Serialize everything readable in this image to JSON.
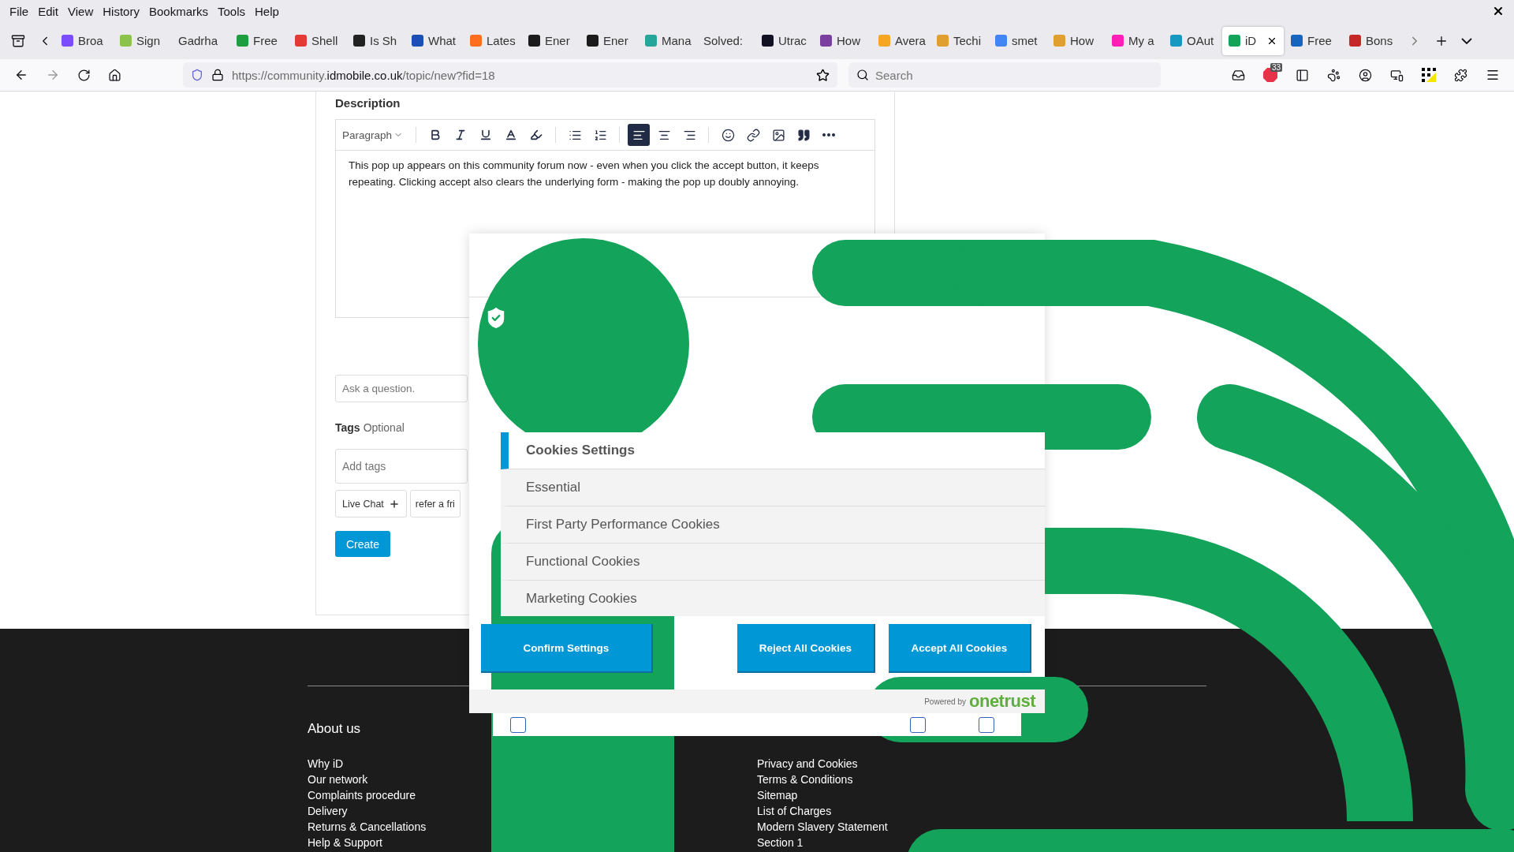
{
  "menu_bar": [
    "File",
    "Edit",
    "View",
    "History",
    "Bookmarks",
    "Tools",
    "Help"
  ],
  "tabs": [
    {
      "label": "Broa",
      "color": "#7c4dff",
      "selected": false
    },
    {
      "label": "Sign",
      "color": "#8bc34a",
      "selected": false
    },
    {
      "label": "Gadrha",
      "selected": false
    },
    {
      "label": "Free",
      "color": "#1e9e3e",
      "selected": false
    },
    {
      "label": "Shell",
      "color": "#e53935",
      "selected": false
    },
    {
      "label": "Is Sh",
      "color": "#222222",
      "selected": false
    },
    {
      "label": "What",
      "color": "#1a4fb5",
      "selected": false
    },
    {
      "label": "Lates",
      "color": "#ff6d1f",
      "selected": false
    },
    {
      "label": "Ener",
      "color": "#1b1b1b",
      "selected": false
    },
    {
      "label": "Ener",
      "color": "#1b1b1b",
      "selected": false
    },
    {
      "label": "Mana",
      "color": "#26a69a",
      "selected": false
    },
    {
      "label": "Solved:",
      "selected": false
    },
    {
      "label": "Utrac",
      "color": "#111122",
      "selected": false
    },
    {
      "label": "How",
      "color": "#7b3fa0",
      "selected": false
    },
    {
      "label": "Avera",
      "color": "#f5a623",
      "selected": false
    },
    {
      "label": "Techi",
      "color": "#e0a030",
      "selected": false
    },
    {
      "label": "smet",
      "color": "#4285f4",
      "selected": false
    },
    {
      "label": "How",
      "color": "#e0a030",
      "selected": false
    },
    {
      "label": "My a",
      "color": "#ff1fb8",
      "selected": false
    },
    {
      "label": "OAut",
      "color": "#1798c1",
      "selected": false
    },
    {
      "label": "iD",
      "color": "#13a35a",
      "selected": true
    },
    {
      "label": "Free",
      "color": "#1565c0",
      "selected": false
    },
    {
      "label": "Bons",
      "color": "#c62828",
      "selected": false
    }
  ],
  "address_bar": {
    "url_prefix": "https://community.",
    "url_domain": "idmobile.co.uk",
    "url_path": "/topic/new?fid=18"
  },
  "search": {
    "placeholder": "Search"
  },
  "adblock_badge": "33",
  "form": {
    "description_label": "Description",
    "editor": {
      "format_label": "Paragraph",
      "align_buttons": [
        {
          "selected": true
        },
        {
          "selected": false
        },
        {
          "selected": false
        }
      ],
      "text": "This pop up appears on this community forum now - even when you click the accept button, it keeps repeating. Clicking accept also clears the underlying form - making the pop up doubly annoying."
    },
    "question_placeholder": "Ask a question.",
    "tags_label": "Tags",
    "tags_optional": "Optional",
    "tags_placeholder": "Add tags",
    "tag_chips": [
      "Live Chat",
      "refer a fri"
    ],
    "create_button": "Create"
  },
  "cookie_popup": {
    "menu": [
      {
        "label": "Cookies Settings",
        "selected": true
      },
      {
        "label": "Essential",
        "selected": false
      },
      {
        "label": "First Party Performance Cookies",
        "selected": false
      },
      {
        "label": "Functional Cookies",
        "selected": false
      },
      {
        "label": "Marketing Cookies",
        "selected": false
      }
    ],
    "buttons": [
      "Confirm Settings",
      "Reject All Cookies",
      "Accept All Cookies"
    ],
    "powered_by": "Powered by",
    "brand": "onetrust",
    "checkboxes": [
      {
        "checked": false
      },
      {
        "checked": false
      },
      {
        "checked": false
      }
    ]
  },
  "footer": {
    "about_heading": "About us",
    "about_links": [
      "Why iD",
      "Our network",
      "Complaints procedure",
      "Delivery",
      "Returns & Cancellations",
      "Help & Support"
    ],
    "legal_links": [
      "Privacy and Cookies",
      "Terms & Conditions",
      "Sitemap",
      "List of Charges",
      "Modern Slavery Statement",
      "Section 1"
    ]
  }
}
